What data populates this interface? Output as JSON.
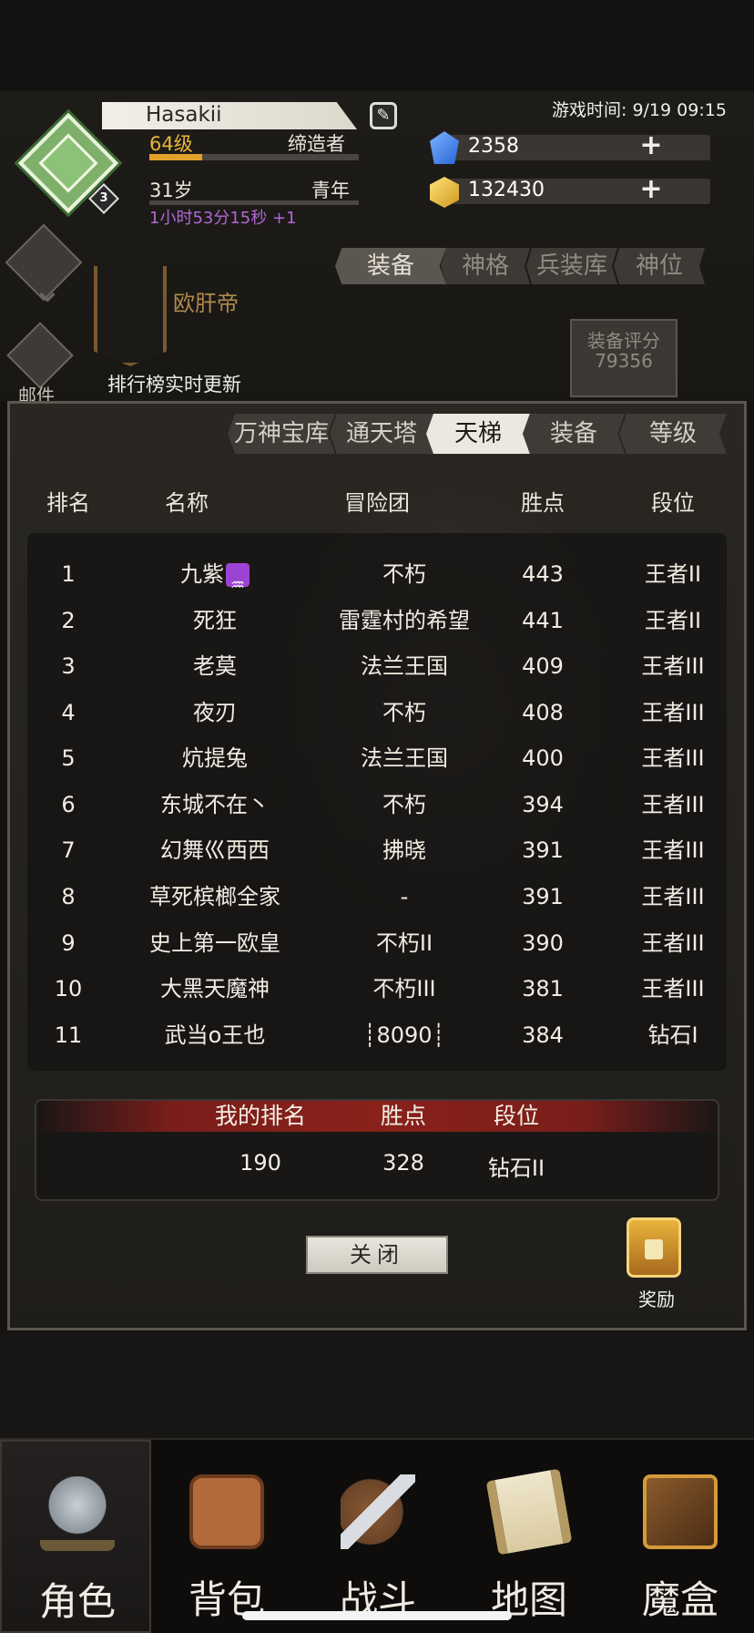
{
  "header": {
    "player_name": "Hasakii",
    "level_badge": "3",
    "level": "64级",
    "level_progress": 0.25,
    "class_title": "缔造者",
    "age": "31岁",
    "life_stage": "青年",
    "age_timer": "1小时53分15秒 +1",
    "game_time": "游戏时间: 9/19 09:15",
    "gems": "2358",
    "gold": "132430",
    "plus": "+"
  },
  "left_nav": {
    "mail_label": "邮件",
    "title_text": "欧肝帝",
    "rank_update": "排行榜实时更新"
  },
  "top_tabs": [
    "装备",
    "神格",
    "兵装库",
    "神位"
  ],
  "equip_score": {
    "label": "装备评分",
    "value": "79356"
  },
  "modal": {
    "tabs": [
      "万神宝库",
      "通天塔",
      "天梯",
      "装备",
      "等级"
    ],
    "active_tab": 2,
    "columns": {
      "rank": "排名",
      "name": "名称",
      "guild": "冒险团",
      "points": "胜点",
      "tier": "段位"
    },
    "rows": [
      {
        "rank": "1",
        "name": "九紫",
        "guild": "不朽",
        "points": "443",
        "tier": "王者II"
      },
      {
        "rank": "2",
        "name": "死狂",
        "guild": "雷霆村的希望",
        "points": "441",
        "tier": "王者II"
      },
      {
        "rank": "3",
        "name": "老莫",
        "guild": "法兰王国",
        "points": "409",
        "tier": "王者III"
      },
      {
        "rank": "4",
        "name": "夜刃",
        "guild": "不朽",
        "points": "408",
        "tier": "王者III"
      },
      {
        "rank": "5",
        "name": "炕提兔",
        "guild": "法兰王国",
        "points": "400",
        "tier": "王者III"
      },
      {
        "rank": "6",
        "name": "东城不在丶",
        "guild": "不朽",
        "points": "394",
        "tier": "王者III"
      },
      {
        "rank": "7",
        "name": "幻舞巛西西",
        "guild": "拂晓",
        "points": "391",
        "tier": "王者III"
      },
      {
        "rank": "8",
        "name": "草死槟榔全家",
        "guild": "-",
        "points": "391",
        "tier": "王者III"
      },
      {
        "rank": "9",
        "name": "史上第一欧皇",
        "guild": "不朽II",
        "points": "390",
        "tier": "王者III"
      },
      {
        "rank": "10",
        "name": "大黑天魔神",
        "guild": "不朽III",
        "points": "381",
        "tier": "王者III"
      },
      {
        "rank": "11",
        "name": "武当o王也",
        "guild": "┊8090┊",
        "points": "384",
        "tier": "钻石I"
      }
    ],
    "zodiac_glyph": "♒",
    "my_rank": {
      "rank_label": "我的排名",
      "points_label": "胜点",
      "tier_label": "段位",
      "rank": "190",
      "points": "328",
      "tier": "钻石II"
    },
    "close_label": "关闭",
    "reward_label": "奖励"
  },
  "bottom_tabs": [
    {
      "label": "角色",
      "icon": "helmet-icon"
    },
    {
      "label": "背包",
      "icon": "backpack-icon"
    },
    {
      "label": "战斗",
      "icon": "sword-shield-icon"
    },
    {
      "label": "地图",
      "icon": "scroll-icon"
    },
    {
      "label": "魔盒",
      "icon": "magic-box-icon"
    }
  ],
  "colors": {
    "accent_gold": "#e8b63a",
    "timer_purple": "#b067d6",
    "header_red": "#8a211b"
  }
}
